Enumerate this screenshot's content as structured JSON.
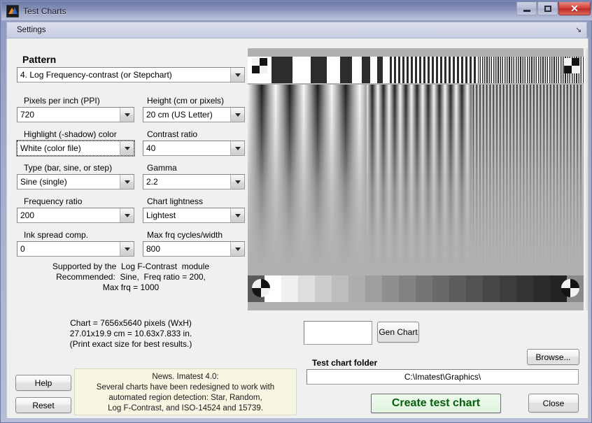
{
  "window": {
    "title": "Test Charts",
    "icon": "matlab-icon",
    "buttons": {
      "minimize": "minimize-icon",
      "maximize": "maximize-icon",
      "close": "✕"
    }
  },
  "menubar": {
    "items": [
      "Settings"
    ],
    "dock_glyph": "↘"
  },
  "pattern_section": {
    "title": "Pattern",
    "selected": "4.   Log Frequency-contrast   (or Stepchart)"
  },
  "fields": [
    {
      "label": "Pixels per inch (PPI)",
      "value": "720",
      "focused": false
    },
    {
      "label": "Height (cm or pixels)",
      "value": "20  cm (US Letter)",
      "focused": false
    },
    {
      "label": "Highlight (-shadow) color",
      "value": "White  (color file)",
      "focused": true
    },
    {
      "label": "Contrast ratio",
      "value": "40",
      "focused": false
    },
    {
      "label": "Type (bar, sine, or step)",
      "value": "Sine (single)",
      "focused": false
    },
    {
      "label": "Gamma",
      "value": "2.2",
      "focused": false
    },
    {
      "label": "Frequency ratio",
      "value": "200",
      "focused": false
    },
    {
      "label": "Chart lightness",
      "value": "Lightest",
      "focused": false
    },
    {
      "label": "Ink spread comp.",
      "value": "0",
      "focused": false
    },
    {
      "label": "Max frq cycles/width",
      "value": "800",
      "focused": false
    }
  ],
  "support_text": "Supported by the  Log F-Contrast  module\nRecommended:  Sine,  Freq ratio = 200,\nMax frq = 1000",
  "chart_info_text": "Chart = 7656x5640 pixels (WxH)\n27.01x19.9 cm = 10.63x7.833 in.\n(Print exact size for best results.)",
  "buttons": {
    "help": "Help",
    "reset": "Reset",
    "gen_chart": "Gen Chart",
    "browse": "Browse...",
    "create": "Create test chart",
    "close": "Close"
  },
  "news": {
    "text": "News.   Imatest 4.0:\nSeveral charts have been redesigned to work with\nautomated region detection:  Star, Random,\nLog F-Contrast, and  ISO-14524 and 15739."
  },
  "gen_chart_field": {
    "value": "",
    "placeholder": ""
  },
  "test_chart_folder": {
    "label": "Test chart folder",
    "value": "C:\\Imatest\\Graphics\\"
  },
  "colors": {
    "accent_green": "#04600a",
    "news_bg": "#f7f6e2",
    "titlebar": "#8892b9",
    "close_red": "#d3453c"
  },
  "chart_preview": {
    "type": "log-frequency-contrast-test-chart",
    "gray_steps": [
      "#ffffff",
      "#efefef",
      "#dedede",
      "#cccccc",
      "#bdbdbd",
      "#adadad",
      "#9e9e9e",
      "#8f8f8f",
      "#828282",
      "#757575",
      "#696969",
      "#5d5d5d",
      "#525252",
      "#474747",
      "#3d3d3d",
      "#343434",
      "#2b2b2b",
      "#232323"
    ]
  }
}
